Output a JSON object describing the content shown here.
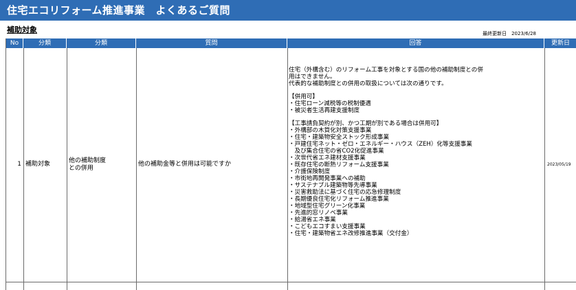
{
  "title": "住宅エコリフォーム推進事業　よくあるご質問",
  "section": "補助対象",
  "last_updated": "最終更新日　2023/6/28",
  "headers": [
    "No",
    "分類",
    "分類",
    "質問",
    "回答",
    "更新日"
  ],
  "row": {
    "no": "1",
    "category1": "補助対象",
    "category2_line1": "他の補助制度",
    "category2_line2": "との併用",
    "question": "他の補助金等と併用は可能ですか",
    "answer_lines": [
      "住宅（外構含む）のリフォーム工事を対象とする国の他の補助制度との併",
      "用はできません。",
      "代表的な補助制度との併用の取扱については次の通りです。",
      "",
      "【併用可】",
      "・住宅ローン減税等の税制優遇",
      "・被災者生活再建支援制度",
      "",
      "【工事請負契約が別、かつ工期が別である場合は併用可】",
      "・外構部の木質化対策支援事業",
      "・住宅・建築物安全ストック形成事業",
      "・戸建住宅ネット・ゼロ・エネルギー・ハウス（ZEH）化等支援事業",
      "　及び集合住宅の省CO2化促進事業",
      "・次世代省エネ建材支援事業",
      "・既存住宅の断熱リフォーム支援事業",
      "・介護保険制度",
      "・市街地再開発事業への補助",
      "・サステナブル建築物等先導事業",
      "・災害救助法に基づく住宅の応急修理制度",
      "・長期優良住宅化リフォーム推進事業",
      "・地域型住宅グリーン化事業",
      "・先進的窓リノベ事業",
      "・給湯省エネ事業",
      "・こどもエコすまい支援事業",
      "・住宅・建築物省エネ改修推進事業（交付金）"
    ],
    "update_date": "2023/05/19"
  },
  "colors": {
    "header_blue": "#2f6db5",
    "grid_line": "#6b6b6b"
  }
}
